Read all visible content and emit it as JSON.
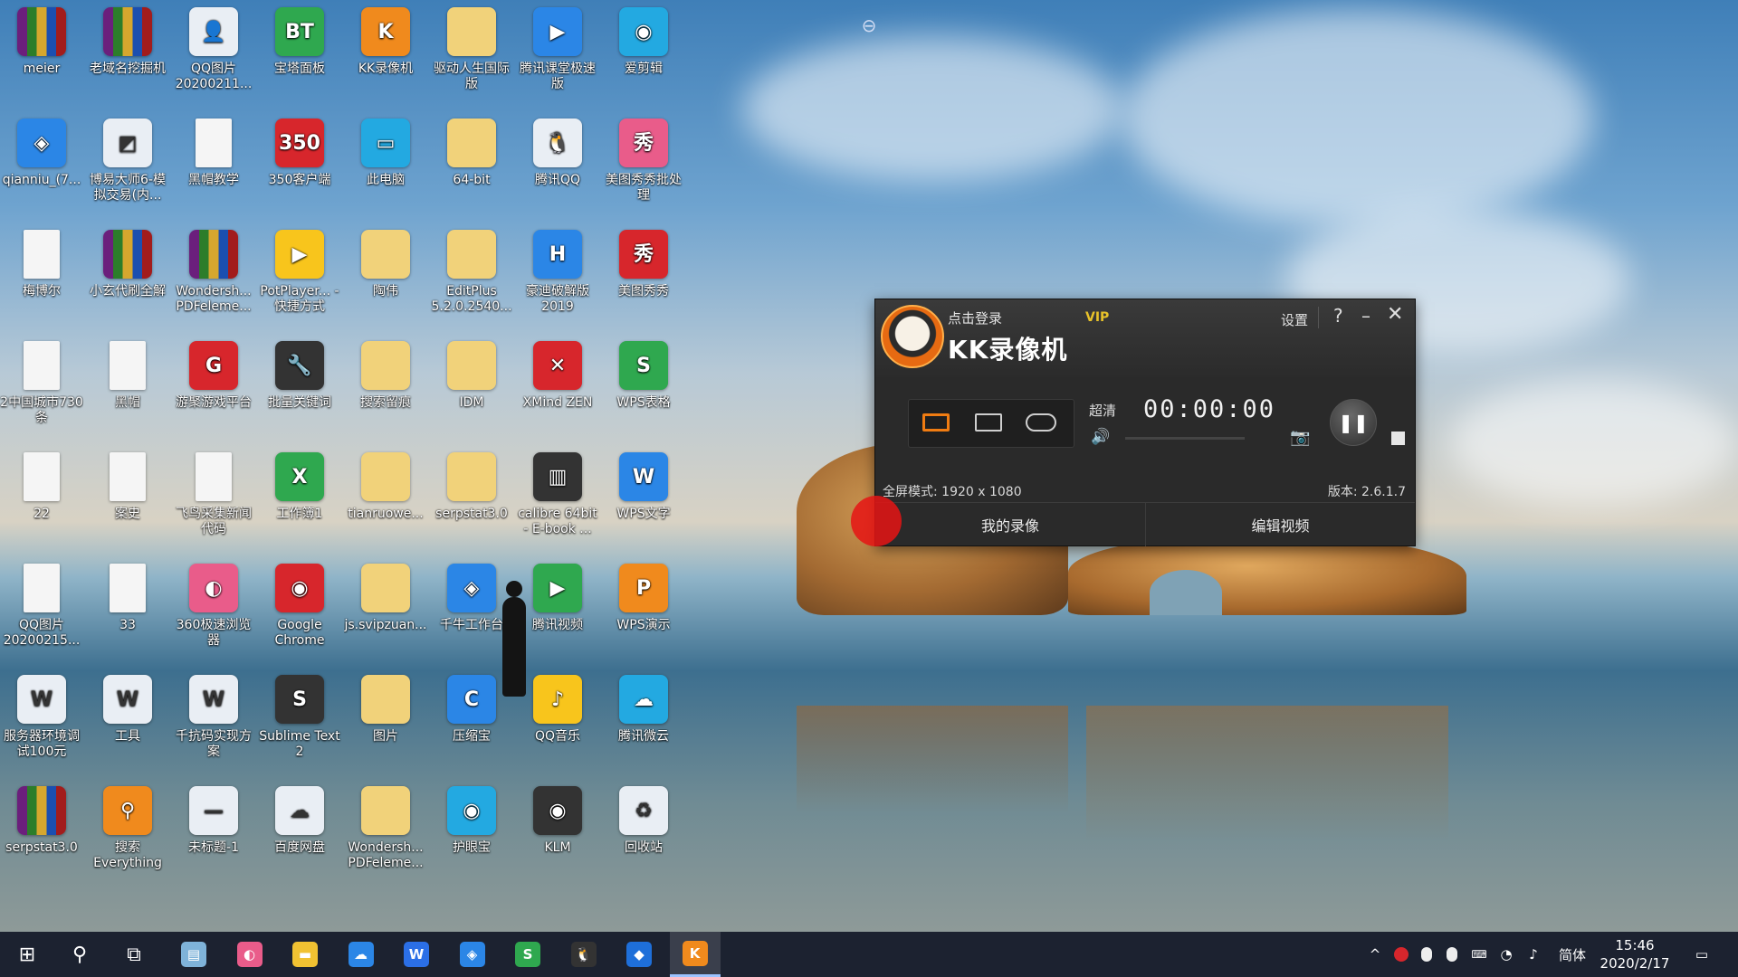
{
  "desktop": {
    "icons": [
      {
        "label": "meier",
        "glyph": "",
        "cls": "g-zip"
      },
      {
        "label": "老域名挖掘机",
        "glyph": "",
        "cls": "g-zip"
      },
      {
        "label": "QQ图片20200211...",
        "glyph": "👤",
        "cls": "g-white"
      },
      {
        "label": "宝塔面板",
        "glyph": "BT",
        "cls": "g-green"
      },
      {
        "label": "KK录像机",
        "glyph": "K",
        "cls": "g-orange"
      },
      {
        "label": "驱动人生国际版",
        "glyph": "",
        "cls": "g-folder"
      },
      {
        "label": "腾讯课堂极速版",
        "glyph": "▶",
        "cls": "g-blue"
      },
      {
        "label": "爱剪辑",
        "glyph": "◉",
        "cls": "g-cyan"
      },
      {
        "label": "qianniu_(7...",
        "glyph": "◈",
        "cls": "g-blue"
      },
      {
        "label": "博易大师6-模拟交易(内...",
        "glyph": "◩",
        "cls": "g-white"
      },
      {
        "label": "黑帽教学",
        "glyph": "",
        "cls": "g-doc"
      },
      {
        "label": "350客户端",
        "glyph": "350",
        "cls": "g-red"
      },
      {
        "label": "此电脑",
        "glyph": "▭",
        "cls": "g-cyan"
      },
      {
        "label": "64-bit",
        "glyph": "",
        "cls": "g-folder"
      },
      {
        "label": "腾讯QQ",
        "glyph": "🐧",
        "cls": "g-white"
      },
      {
        "label": "美图秀秀批处理",
        "glyph": "秀",
        "cls": "g-pink"
      },
      {
        "label": "梅博尔",
        "glyph": "",
        "cls": "g-doc"
      },
      {
        "label": "小玄代刷全解",
        "glyph": "",
        "cls": "g-zip"
      },
      {
        "label": "Wondersh... PDFeleme...",
        "glyph": "",
        "cls": "g-zip"
      },
      {
        "label": "PotPlayer... - 快捷方式",
        "glyph": "▶",
        "cls": "g-yellow"
      },
      {
        "label": "陶伟",
        "glyph": "",
        "cls": "g-folder"
      },
      {
        "label": "EditPlus 5.2.0.2540...",
        "glyph": "",
        "cls": "g-folder"
      },
      {
        "label": "豪迪破解版2019",
        "glyph": "H",
        "cls": "g-blue"
      },
      {
        "label": "美图秀秀",
        "glyph": "秀",
        "cls": "g-red"
      },
      {
        "label": "2中国城市730条",
        "glyph": "",
        "cls": "g-doc"
      },
      {
        "label": "黑帽",
        "glyph": "",
        "cls": "g-doc"
      },
      {
        "label": "游聚游戏平台",
        "glyph": "G",
        "cls": "g-red"
      },
      {
        "label": "批量关键词",
        "glyph": "🔧",
        "cls": "g-dark"
      },
      {
        "label": "搜索留痕",
        "glyph": "",
        "cls": "g-folder"
      },
      {
        "label": "IDM",
        "glyph": "",
        "cls": "g-folder"
      },
      {
        "label": "XMind ZEN",
        "glyph": "✕",
        "cls": "g-red"
      },
      {
        "label": "WPS表格",
        "glyph": "S",
        "cls": "g-green"
      },
      {
        "label": "22",
        "glyph": "",
        "cls": "g-doc"
      },
      {
        "label": "案史",
        "glyph": "",
        "cls": "g-doc"
      },
      {
        "label": "飞鸟采集新闻代码",
        "glyph": "",
        "cls": "g-doc"
      },
      {
        "label": "工作簿1",
        "glyph": "X",
        "cls": "g-green"
      },
      {
        "label": "tianruowe...",
        "glyph": "",
        "cls": "g-folder"
      },
      {
        "label": "serpstat3.0",
        "glyph": "",
        "cls": "g-folder"
      },
      {
        "label": "calibre 64bit - E-book ...",
        "glyph": "▥",
        "cls": "g-dark"
      },
      {
        "label": "WPS文字",
        "glyph": "W",
        "cls": "g-blue"
      },
      {
        "label": "QQ图片20200215...",
        "glyph": "",
        "cls": "g-doc"
      },
      {
        "label": "33",
        "glyph": "",
        "cls": "g-doc"
      },
      {
        "label": "360极速浏览器",
        "glyph": "◐",
        "cls": "g-pink"
      },
      {
        "label": "Google Chrome",
        "glyph": "◉",
        "cls": "g-red"
      },
      {
        "label": "js.svipzuan...",
        "glyph": "",
        "cls": "g-folder"
      },
      {
        "label": "千牛工作台",
        "glyph": "◈",
        "cls": "g-blue"
      },
      {
        "label": "腾讯视频",
        "glyph": "▶",
        "cls": "g-green"
      },
      {
        "label": "WPS演示",
        "glyph": "P",
        "cls": "g-orange"
      },
      {
        "label": "服务器环境调试100元",
        "glyph": "W",
        "cls": "g-white"
      },
      {
        "label": "工具",
        "glyph": "W",
        "cls": "g-white"
      },
      {
        "label": "千抗码实现方案",
        "glyph": "W",
        "cls": "g-white"
      },
      {
        "label": "Sublime Text 2",
        "glyph": "S",
        "cls": "g-dark"
      },
      {
        "label": "图片",
        "glyph": "",
        "cls": "g-folder"
      },
      {
        "label": "压缩宝",
        "glyph": "C",
        "cls": "g-blue"
      },
      {
        "label": "QQ音乐",
        "glyph": "♪",
        "cls": "g-yellow"
      },
      {
        "label": "腾讯微云",
        "glyph": "☁",
        "cls": "g-cyan"
      },
      {
        "label": "serpstat3.0",
        "glyph": "",
        "cls": "g-zip"
      },
      {
        "label": "搜索 Everything",
        "glyph": "⚲",
        "cls": "g-orange"
      },
      {
        "label": "未标题-1",
        "glyph": "—",
        "cls": "g-white"
      },
      {
        "label": "百度网盘",
        "glyph": "☁",
        "cls": "g-white"
      },
      {
        "label": "Wondersh... PDFeleme...",
        "glyph": "",
        "cls": "g-folder"
      },
      {
        "label": "护眼宝",
        "glyph": "◉",
        "cls": "g-cyan"
      },
      {
        "label": "KLM",
        "glyph": "◉",
        "cls": "g-dark"
      },
      {
        "label": "回收站",
        "glyph": "♻",
        "cls": "g-white"
      }
    ]
  },
  "kk_window": {
    "login_text": "点击登录",
    "vip_text": "VIP",
    "app_name": "KK录像机",
    "settings_label": "设置",
    "help_label": "?",
    "minimize_label": "–",
    "close_label": "✕",
    "quality_label": "超清",
    "timer": "00:00:00",
    "volume_icon": "🔊",
    "snapshot_icon": "📷",
    "pause_label": "❚❚",
    "mode_text": "全屏模式: 1920 x 1080",
    "version_text": "版本: 2.6.1.7",
    "tab_my_recordings": "我的录像",
    "tab_edit_video": "编辑视频",
    "accent_color": "#f07c12"
  },
  "taskbar": {
    "start_icon": "⊞",
    "search_icon": "⚲",
    "taskview_icon": "⧉",
    "apps": [
      {
        "name": "notes-app-icon",
        "glyph": "▤",
        "color": "#7fb3d9"
      },
      {
        "name": "360-browser-icon",
        "glyph": "◐",
        "color": "#e95c8a"
      },
      {
        "name": "file-explorer-icon",
        "glyph": "▬",
        "color": "#f1c232"
      },
      {
        "name": "weiyun-icon",
        "glyph": "☁",
        "color": "#2b86e6"
      },
      {
        "name": "wps-writer-icon",
        "glyph": "W",
        "color": "#2b6fe6"
      },
      {
        "name": "qianniu-icon",
        "glyph": "◈",
        "color": "#2b86e6"
      },
      {
        "name": "wps-sheet-icon",
        "glyph": "S",
        "color": "#2fa84f"
      },
      {
        "name": "qq-icon",
        "glyph": "🐧",
        "color": "#333333"
      },
      {
        "name": "xunlei-icon",
        "glyph": "◆",
        "color": "#1e6fd9"
      },
      {
        "name": "kk-recorder-icon",
        "glyph": "K",
        "color": "#f08a1d"
      }
    ],
    "tray": {
      "chevron": "^",
      "ime_label": "简体",
      "time": "15:46",
      "date": "2020/2/17",
      "notification_icon": "▭"
    }
  }
}
